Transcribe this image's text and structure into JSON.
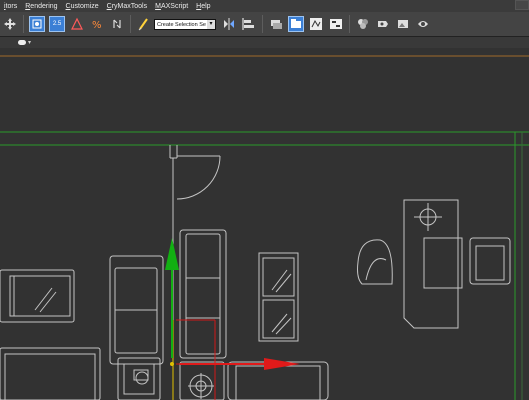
{
  "menu": {
    "items": [
      "itors",
      "Rendering",
      "Customize",
      "CryMaxTools",
      "MAXScript",
      "Help"
    ]
  },
  "toolbar": {
    "selection_set_placeholder": "Create Selection Se",
    "snap_label": "2.5"
  },
  "colors": {
    "menubar_bg": "#3b3b3b",
    "toolbar_bg": "#444444",
    "viewport_bg": "#323232",
    "active_tool": "#3b7fd5",
    "gizmo_x": "#e01a1a",
    "gizmo_y": "#12b012",
    "wireframe": "#c4c4c4"
  },
  "icons": [
    "move-icon",
    "select-object-icon",
    "snaps-toggle-icon",
    "angle-snap-icon",
    "percent-snap-icon",
    "spinner-snap-icon",
    "edit-named-selections-icon",
    "mirror-icon",
    "align-icon",
    "layer-manager-icon",
    "graphite-ribbon-icon",
    "curve-editor-icon",
    "schematic-view-icon",
    "material-editor-icon",
    "render-setup-icon",
    "rendered-frame-window-icon",
    "render-production-icon",
    "eye-icon"
  ]
}
